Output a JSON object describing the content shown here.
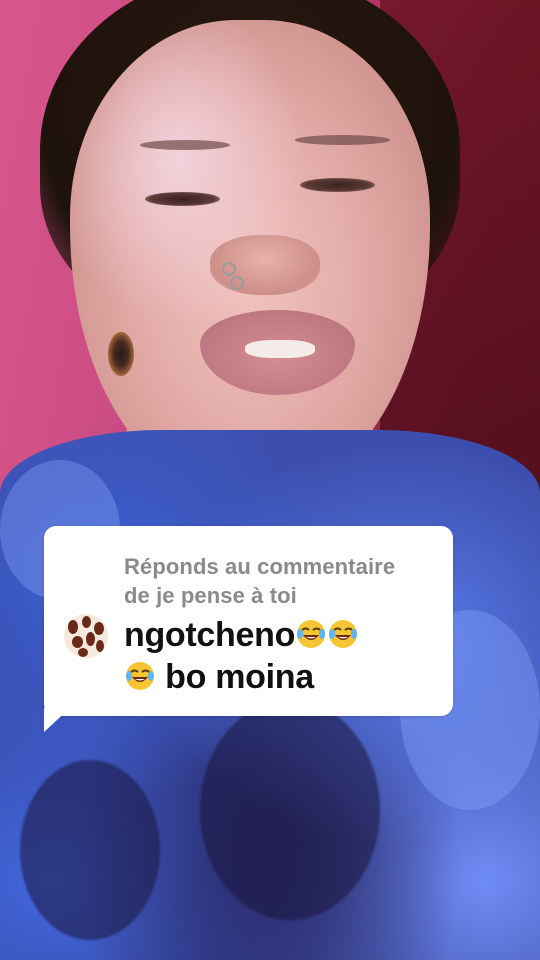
{
  "reply": {
    "header_line1": "Réponds au commentaire",
    "header_line2": "de je pense à toi",
    "comment_username": "ngotcheno",
    "comment_tail": "bo moina",
    "emoji_name": "face-with-tears-of-joy"
  },
  "colors": {
    "bubble_bg": "#ffffff",
    "header_text": "#8a8a8a",
    "comment_text": "#111111",
    "shirt_blue": "#3d4fae",
    "wall_pink": "#d9578d"
  }
}
